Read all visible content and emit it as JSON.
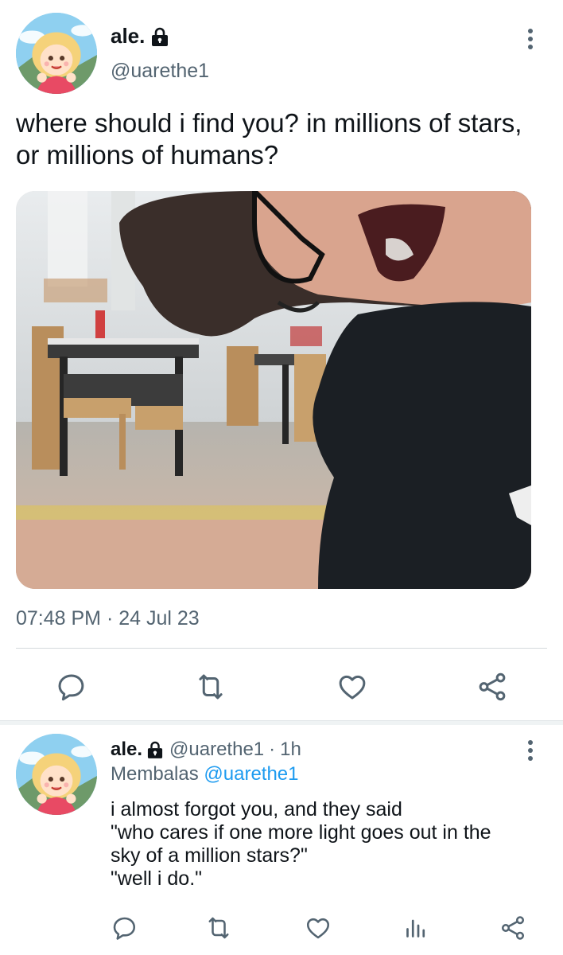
{
  "main_tweet": {
    "display_name": "ale.",
    "handle": "@uarethe1",
    "text": "where should i find you? in millions of stars, or millions of humans?",
    "timestamp": "07:48 PM · 24 Jul 23",
    "icons": {
      "lock": "lock-icon",
      "more": "more-vertical-icon",
      "reply": "reply-icon",
      "retweet": "retweet-icon",
      "like": "heart-icon",
      "share": "share-icon"
    }
  },
  "reply_tweet": {
    "display_name": "ale.",
    "handle": "@uarethe1",
    "separator": "·",
    "time_ago": "1h",
    "replying_prefix": "Membalas",
    "replying_to": "@uarethe1",
    "text_lines": [
      "i almost forgot you, and they said",
      "\"who cares if one more light goes out in the",
      "sky of a million stars?\"",
      "\"well i do.\""
    ],
    "icons": {
      "reply": "reply-icon",
      "retweet": "retweet-icon",
      "like": "heart-icon",
      "views": "views-chart-icon",
      "share": "share-icon"
    }
  },
  "colors": {
    "text_primary": "#0f1419",
    "text_secondary": "#536471",
    "link": "#1d9bf0",
    "divider": "#d4d9dc"
  }
}
